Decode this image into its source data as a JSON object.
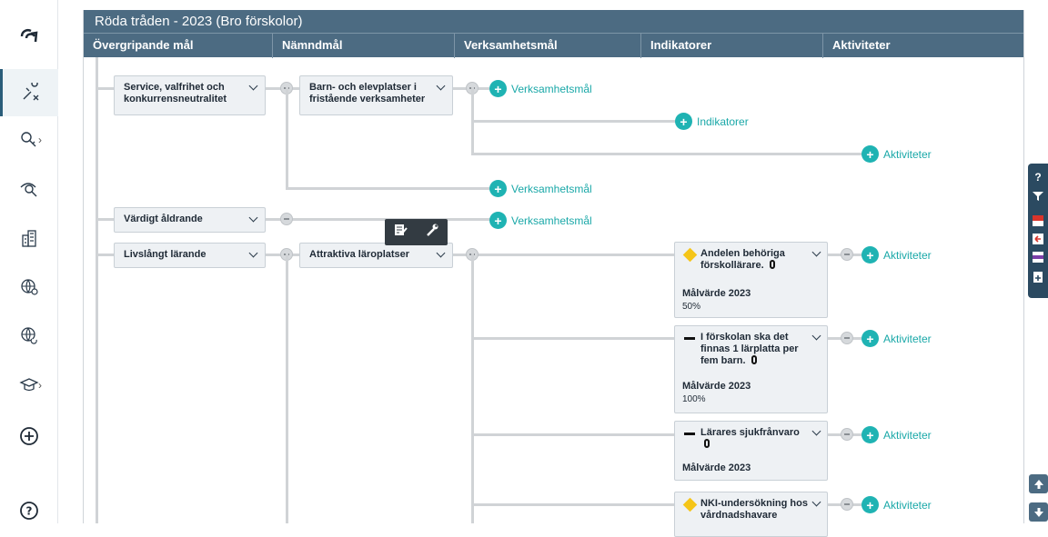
{
  "board": {
    "title": "Röda tråden - 2023 (Bro förskolor)",
    "columns": [
      "Övergripande mål",
      "Nämndmål",
      "Verksamhetsmål",
      "Indikatorer",
      "Aktiviteter"
    ]
  },
  "goals": [
    {
      "label": "Service, valfrihet och konkurrensneutralitet"
    },
    {
      "label": "Värdigt åldrande"
    },
    {
      "label": "Livslångt lärande"
    }
  ],
  "namnd": [
    {
      "label": "Barn- och elevplatser i fristående verksamheter"
    },
    {
      "label": "Attraktiva läroplatser"
    }
  ],
  "add": {
    "verksamhetsmal": "Verksamhetsmål",
    "indikatorer": "Indikatorer",
    "aktiviteter": "Aktiviteter"
  },
  "indicators": [
    {
      "title": "Andelen behöriga förskollärare.",
      "status": "yellow",
      "target_label": "Målvärde 2023",
      "target_value": "50%"
    },
    {
      "title": "I förskolan ska det finnas 1 lärplatta per fem barn.",
      "status": "none",
      "target_label": "Målvärde 2023",
      "target_value": "100%"
    },
    {
      "title": "Lärares sjukfrånvaro",
      "status": "none",
      "target_label": "Målvärde 2023",
      "target_value": ""
    },
    {
      "title": "NKI-undersökning hos vårdnadshavare",
      "status": "yellow",
      "target_label": "",
      "target_value": ""
    }
  ],
  "icons": {
    "logo": "app-logo-icon",
    "nav": [
      "compass-icon",
      "key-icon",
      "eye-search-icon",
      "building-icon",
      "globe-person-icon",
      "globe-refresh-icon",
      "graduation-cap-icon",
      "add-circle-icon",
      "help-circle-icon"
    ],
    "right": [
      "help-icon",
      "filter-icon",
      "pdf-icon",
      "export-icon",
      "web-icon",
      "document-add-icon"
    ]
  },
  "colors": {
    "header": "#4c6b82",
    "accent": "#1fb3b3",
    "status_yellow": "#f5c518"
  }
}
